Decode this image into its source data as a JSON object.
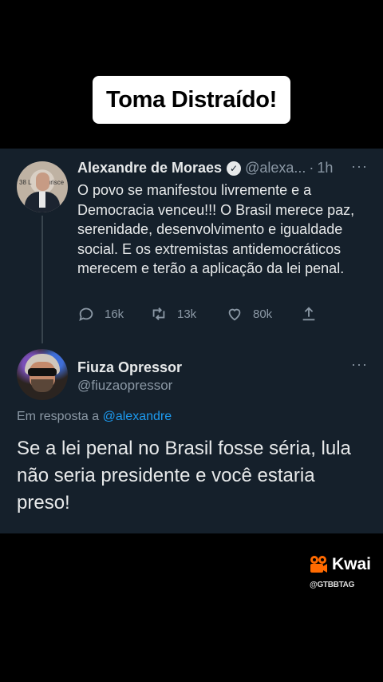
{
  "caption": "Toma Distraído!",
  "tweet": {
    "author_name": "Alexandre de Moraes",
    "verified_icon": "verified-badge-icon",
    "handle": "@alexa...",
    "separator": "·",
    "time": "1h",
    "more": "···",
    "avatar_text_left": "38 L",
    "avatar_text_right": "ırisce",
    "text": "O povo se manifestou livremente e a Democracia venceu!!! O Brasil merece paz, serenidade, desenvolvimento e igualdade social. E os extremistas antidemocráticos merecem e terão a aplicação da lei penal.",
    "actions": {
      "reply_count": "16k",
      "retweet_count": "13k",
      "like_count": "80k"
    }
  },
  "reply": {
    "author_name": "Fiuza Opressor",
    "handle": "@fiuzaopressor",
    "more": "···",
    "replying_prefix": "Em resposta a ",
    "replying_to": "@alexandre",
    "text": "Se a lei penal no Brasil fosse séria, lula não seria presidente e você estaria preso!"
  },
  "kwai": {
    "brand": "Kwai",
    "watermark": "@GTBBTAG"
  },
  "colors": {
    "card_bg": "#15202b",
    "text": "#e7e9ea",
    "muted": "#8b98a5",
    "link": "#1d9bf0",
    "kwai_orange": "#ff6a00"
  }
}
